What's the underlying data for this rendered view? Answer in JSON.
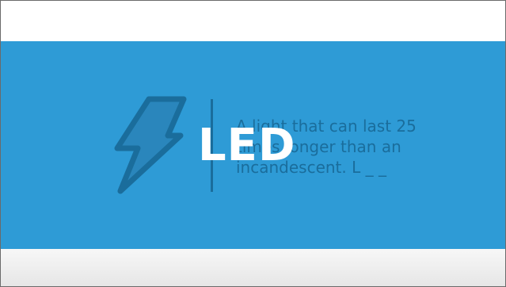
{
  "slide": {
    "clue_text": "A light that can last 25 times longer than an incandescent. L _ _",
    "answer_text": "LED",
    "icon": "lightning-bolt-icon",
    "colors": {
      "banner": "#2e9bd6",
      "icon_and_text": "#1a6d9c",
      "answer": "#ffffff"
    }
  }
}
